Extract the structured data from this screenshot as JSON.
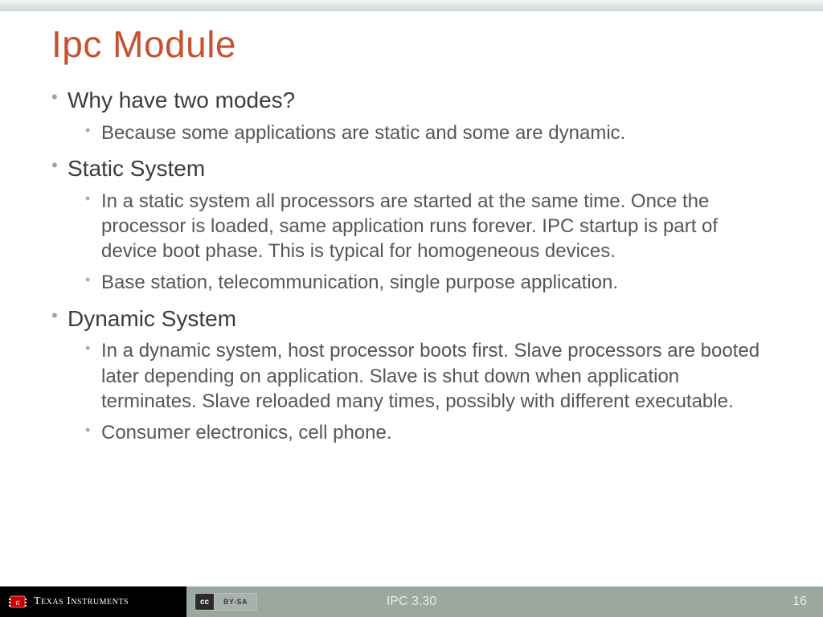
{
  "title": "Ipc Module",
  "bullets": {
    "b1": {
      "text": "Why have two modes?"
    },
    "b1s1": "Because some applications are static and some are dynamic.",
    "b2": {
      "text": "Static System"
    },
    "b2s1": "In a static system all processors are started at the same time. Once the processor is loaded, same application runs forever. IPC startup is part of device boot phase. This is typical for homogeneous devices.",
    "b2s2": "Base station, telecommunication, single purpose application.",
    "b3": {
      "text": "Dynamic System"
    },
    "b3s1": "In a dynamic system, host processor boots first. Slave processors are booted later depending on application. Slave is shut down when application terminates. Slave reloaded many times, possibly with different executable.",
    "b3s2": "Consumer electronics, cell phone."
  },
  "footer": {
    "company": "Texas Instruments",
    "cc_left": "cc",
    "cc_right": "BY-SA",
    "center": "IPC 3.30",
    "page": "16"
  }
}
